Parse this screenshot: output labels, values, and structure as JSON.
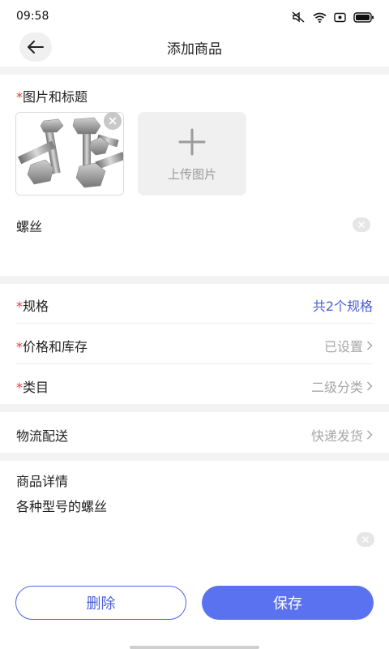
{
  "status_bar": {
    "time": "09:58"
  },
  "nav": {
    "title": "添加商品"
  },
  "image_section": {
    "required_mark": "*",
    "title": "图片和标题",
    "upload_label": "上传图片"
  },
  "product_title": {
    "value": "螺丝"
  },
  "rows": {
    "spec": {
      "required_mark": "*",
      "label": "规格",
      "value": "共2个规格"
    },
    "price_stock": {
      "required_mark": "*",
      "label": "价格和库存",
      "value": "已设置"
    },
    "category": {
      "required_mark": "*",
      "label": "类目",
      "value": "二级分类"
    },
    "logistics": {
      "label": "物流配送",
      "value": "快递发货"
    }
  },
  "detail": {
    "title": "商品详情",
    "text": "各种型号的螺丝"
  },
  "buttons": {
    "delete": "删除",
    "save": "保存"
  },
  "colors": {
    "accent": "#5b72f0",
    "required": "#e5393a",
    "muted": "#a6a6a6"
  }
}
